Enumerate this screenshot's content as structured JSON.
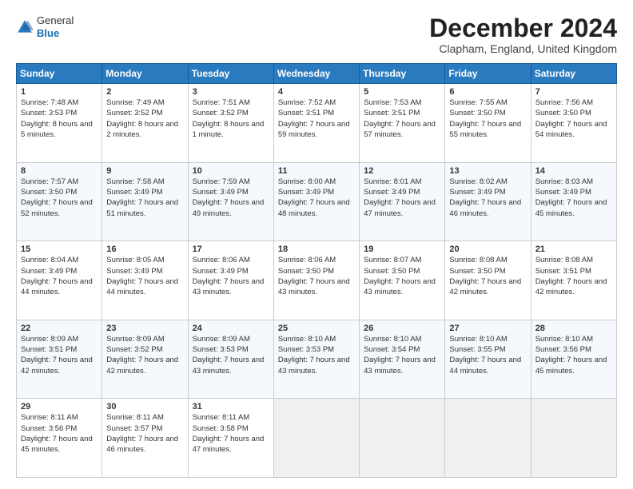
{
  "header": {
    "logo_line1": "General",
    "logo_line2": "Blue",
    "month": "December 2024",
    "location": "Clapham, England, United Kingdom"
  },
  "weekdays": [
    "Sunday",
    "Monday",
    "Tuesday",
    "Wednesday",
    "Thursday",
    "Friday",
    "Saturday"
  ],
  "weeks": [
    [
      {
        "day": "1",
        "sunrise": "Sunrise: 7:48 AM",
        "sunset": "Sunset: 3:53 PM",
        "daylight": "Daylight: 8 hours and 5 minutes."
      },
      {
        "day": "2",
        "sunrise": "Sunrise: 7:49 AM",
        "sunset": "Sunset: 3:52 PM",
        "daylight": "Daylight: 8 hours and 2 minutes."
      },
      {
        "day": "3",
        "sunrise": "Sunrise: 7:51 AM",
        "sunset": "Sunset: 3:52 PM",
        "daylight": "Daylight: 8 hours and 1 minute."
      },
      {
        "day": "4",
        "sunrise": "Sunrise: 7:52 AM",
        "sunset": "Sunset: 3:51 PM",
        "daylight": "Daylight: 7 hours and 59 minutes."
      },
      {
        "day": "5",
        "sunrise": "Sunrise: 7:53 AM",
        "sunset": "Sunset: 3:51 PM",
        "daylight": "Daylight: 7 hours and 57 minutes."
      },
      {
        "day": "6",
        "sunrise": "Sunrise: 7:55 AM",
        "sunset": "Sunset: 3:50 PM",
        "daylight": "Daylight: 7 hours and 55 minutes."
      },
      {
        "day": "7",
        "sunrise": "Sunrise: 7:56 AM",
        "sunset": "Sunset: 3:50 PM",
        "daylight": "Daylight: 7 hours and 54 minutes."
      }
    ],
    [
      {
        "day": "8",
        "sunrise": "Sunrise: 7:57 AM",
        "sunset": "Sunset: 3:50 PM",
        "daylight": "Daylight: 7 hours and 52 minutes."
      },
      {
        "day": "9",
        "sunrise": "Sunrise: 7:58 AM",
        "sunset": "Sunset: 3:49 PM",
        "daylight": "Daylight: 7 hours and 51 minutes."
      },
      {
        "day": "10",
        "sunrise": "Sunrise: 7:59 AM",
        "sunset": "Sunset: 3:49 PM",
        "daylight": "Daylight: 7 hours and 49 minutes."
      },
      {
        "day": "11",
        "sunrise": "Sunrise: 8:00 AM",
        "sunset": "Sunset: 3:49 PM",
        "daylight": "Daylight: 7 hours and 48 minutes."
      },
      {
        "day": "12",
        "sunrise": "Sunrise: 8:01 AM",
        "sunset": "Sunset: 3:49 PM",
        "daylight": "Daylight: 7 hours and 47 minutes."
      },
      {
        "day": "13",
        "sunrise": "Sunrise: 8:02 AM",
        "sunset": "Sunset: 3:49 PM",
        "daylight": "Daylight: 7 hours and 46 minutes."
      },
      {
        "day": "14",
        "sunrise": "Sunrise: 8:03 AM",
        "sunset": "Sunset: 3:49 PM",
        "daylight": "Daylight: 7 hours and 45 minutes."
      }
    ],
    [
      {
        "day": "15",
        "sunrise": "Sunrise: 8:04 AM",
        "sunset": "Sunset: 3:49 PM",
        "daylight": "Daylight: 7 hours and 44 minutes."
      },
      {
        "day": "16",
        "sunrise": "Sunrise: 8:05 AM",
        "sunset": "Sunset: 3:49 PM",
        "daylight": "Daylight: 7 hours and 44 minutes."
      },
      {
        "day": "17",
        "sunrise": "Sunrise: 8:06 AM",
        "sunset": "Sunset: 3:49 PM",
        "daylight": "Daylight: 7 hours and 43 minutes."
      },
      {
        "day": "18",
        "sunrise": "Sunrise: 8:06 AM",
        "sunset": "Sunset: 3:50 PM",
        "daylight": "Daylight: 7 hours and 43 minutes."
      },
      {
        "day": "19",
        "sunrise": "Sunrise: 8:07 AM",
        "sunset": "Sunset: 3:50 PM",
        "daylight": "Daylight: 7 hours and 43 minutes."
      },
      {
        "day": "20",
        "sunrise": "Sunrise: 8:08 AM",
        "sunset": "Sunset: 3:50 PM",
        "daylight": "Daylight: 7 hours and 42 minutes."
      },
      {
        "day": "21",
        "sunrise": "Sunrise: 8:08 AM",
        "sunset": "Sunset: 3:51 PM",
        "daylight": "Daylight: 7 hours and 42 minutes."
      }
    ],
    [
      {
        "day": "22",
        "sunrise": "Sunrise: 8:09 AM",
        "sunset": "Sunset: 3:51 PM",
        "daylight": "Daylight: 7 hours and 42 minutes."
      },
      {
        "day": "23",
        "sunrise": "Sunrise: 8:09 AM",
        "sunset": "Sunset: 3:52 PM",
        "daylight": "Daylight: 7 hours and 42 minutes."
      },
      {
        "day": "24",
        "sunrise": "Sunrise: 8:09 AM",
        "sunset": "Sunset: 3:53 PM",
        "daylight": "Daylight: 7 hours and 43 minutes."
      },
      {
        "day": "25",
        "sunrise": "Sunrise: 8:10 AM",
        "sunset": "Sunset: 3:53 PM",
        "daylight": "Daylight: 7 hours and 43 minutes."
      },
      {
        "day": "26",
        "sunrise": "Sunrise: 8:10 AM",
        "sunset": "Sunset: 3:54 PM",
        "daylight": "Daylight: 7 hours and 43 minutes."
      },
      {
        "day": "27",
        "sunrise": "Sunrise: 8:10 AM",
        "sunset": "Sunset: 3:55 PM",
        "daylight": "Daylight: 7 hours and 44 minutes."
      },
      {
        "day": "28",
        "sunrise": "Sunrise: 8:10 AM",
        "sunset": "Sunset: 3:56 PM",
        "daylight": "Daylight: 7 hours and 45 minutes."
      }
    ],
    [
      {
        "day": "29",
        "sunrise": "Sunrise: 8:11 AM",
        "sunset": "Sunset: 3:56 PM",
        "daylight": "Daylight: 7 hours and 45 minutes."
      },
      {
        "day": "30",
        "sunrise": "Sunrise: 8:11 AM",
        "sunset": "Sunset: 3:57 PM",
        "daylight": "Daylight: 7 hours and 46 minutes."
      },
      {
        "day": "31",
        "sunrise": "Sunrise: 8:11 AM",
        "sunset": "Sunset: 3:58 PM",
        "daylight": "Daylight: 7 hours and 47 minutes."
      },
      null,
      null,
      null,
      null
    ]
  ]
}
